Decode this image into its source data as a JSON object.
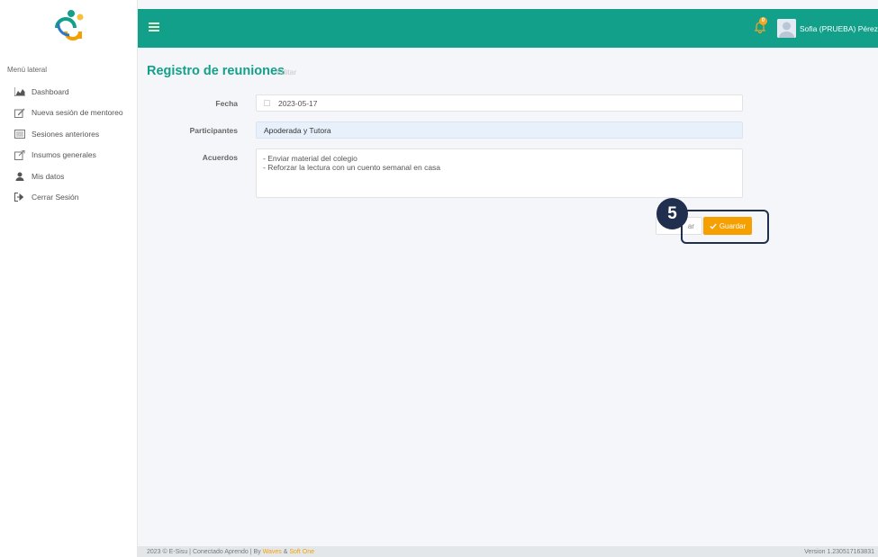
{
  "brand": {
    "accent": "#12a08a",
    "highlight": "#f6a000",
    "logo_name": "conectado-aprendo-logo"
  },
  "header": {
    "notifications_count": "0",
    "user_name": "Sofia (PRUEBA) Pérez",
    "user_caret": "▾"
  },
  "sidebar": {
    "title": "Menú lateral",
    "items": [
      {
        "label": "Dashboard",
        "icon": "chart-area-icon"
      },
      {
        "label": "Nueva sesión de mentoreo",
        "icon": "edit-icon"
      },
      {
        "label": "Sesiones anteriores",
        "icon": "list-icon"
      },
      {
        "label": "Insumos generales",
        "icon": "external-link-icon"
      },
      {
        "label": "Mis datos",
        "icon": "user-icon"
      },
      {
        "label": "Cerrar Sesión",
        "icon": "sign-out-icon"
      }
    ]
  },
  "main": {
    "title": "Registro de reuniones",
    "subtitle": "Editar",
    "fecha_label": "Fecha",
    "fecha_value": "2023-05-17",
    "participantes_label": "Participantes",
    "participantes_value": "Apoderada y Tutora",
    "acuerdos_label": "Acuerdos",
    "acuerdos_value": "- Enviar material del colegio\n- Reforzar la lectura con un cuento semanal en casa",
    "cancel_label": "ar",
    "save_label": "Guardar",
    "step_number": "5"
  },
  "footer": {
    "left_prefix": "2023 © E-Sisu | Conectado Aprendo | By ",
    "link1": "Waves",
    "amp": " & ",
    "link2": "Soft One",
    "version": "Version 1.230517163831"
  }
}
